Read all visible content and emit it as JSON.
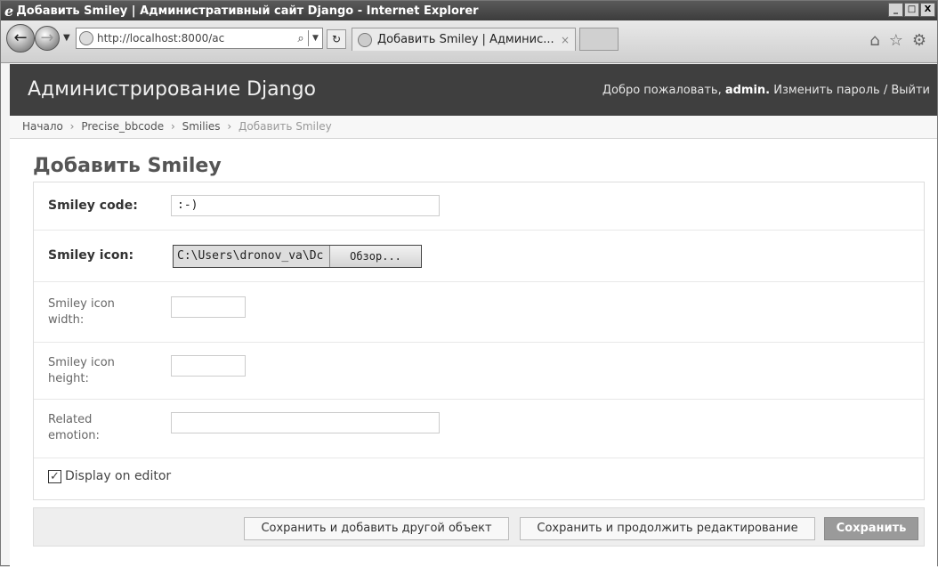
{
  "window": {
    "title": "Добавить Smiley | Административный сайт Django - Internet Explorer",
    "minimize": "_",
    "maximize": "□",
    "close": "X"
  },
  "browser": {
    "url": "http://localhost:8000/ac",
    "tab_title": "Добавить Smiley | Админис...",
    "tab_close": "×",
    "refresh_glyph": "↻",
    "icons": [
      "home-icon",
      "star-icon",
      "gear-icon"
    ]
  },
  "header": {
    "brand": "Администрирование Django",
    "welcome": "Добро пожаловать,",
    "username": "admin.",
    "change_password": "Изменить пароль",
    "separator": "/",
    "logout": "Выйти"
  },
  "breadcrumbs": {
    "home": "Начало",
    "app": "Precise_bbcode",
    "model": "Smilies",
    "current": "Добавить Smiley",
    "sep": "›"
  },
  "page": {
    "title": "Добавить Smiley"
  },
  "form": {
    "code_label": "Smiley code:",
    "code_value": ":-)",
    "icon_label": "Smiley icon:",
    "icon_path": "C:\\Users\\dronov_va\\Dc",
    "icon_browse": "Обзор...",
    "width_label": "Smiley icon width:",
    "width_value": "",
    "height_label": "Smiley icon height:",
    "height_value": "",
    "emotion_label": "Related emotion:",
    "emotion_value": "",
    "display_label": "Display on editor",
    "display_checked": true
  },
  "actions": {
    "save_add": "Сохранить и добавить другой объект",
    "save_continue": "Сохранить и продолжить редактирование",
    "save": "Сохранить"
  }
}
